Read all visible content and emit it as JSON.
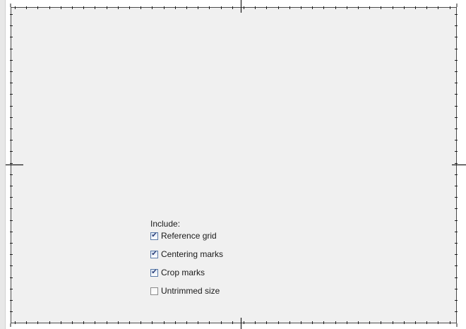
{
  "include": {
    "heading": "Include:",
    "options": [
      {
        "label": "Reference grid",
        "checked": true
      },
      {
        "label": "Centering marks",
        "checked": true
      },
      {
        "label": "Crop marks",
        "checked": true
      },
      {
        "label": "Untrimmed size",
        "checked": false
      }
    ]
  },
  "icons": {
    "check": "checkmark-icon"
  },
  "colors": {
    "sheet_background": "#f0f0f0",
    "sheet_border": "#4a4a4a",
    "check_mark": "#2b3f78"
  }
}
